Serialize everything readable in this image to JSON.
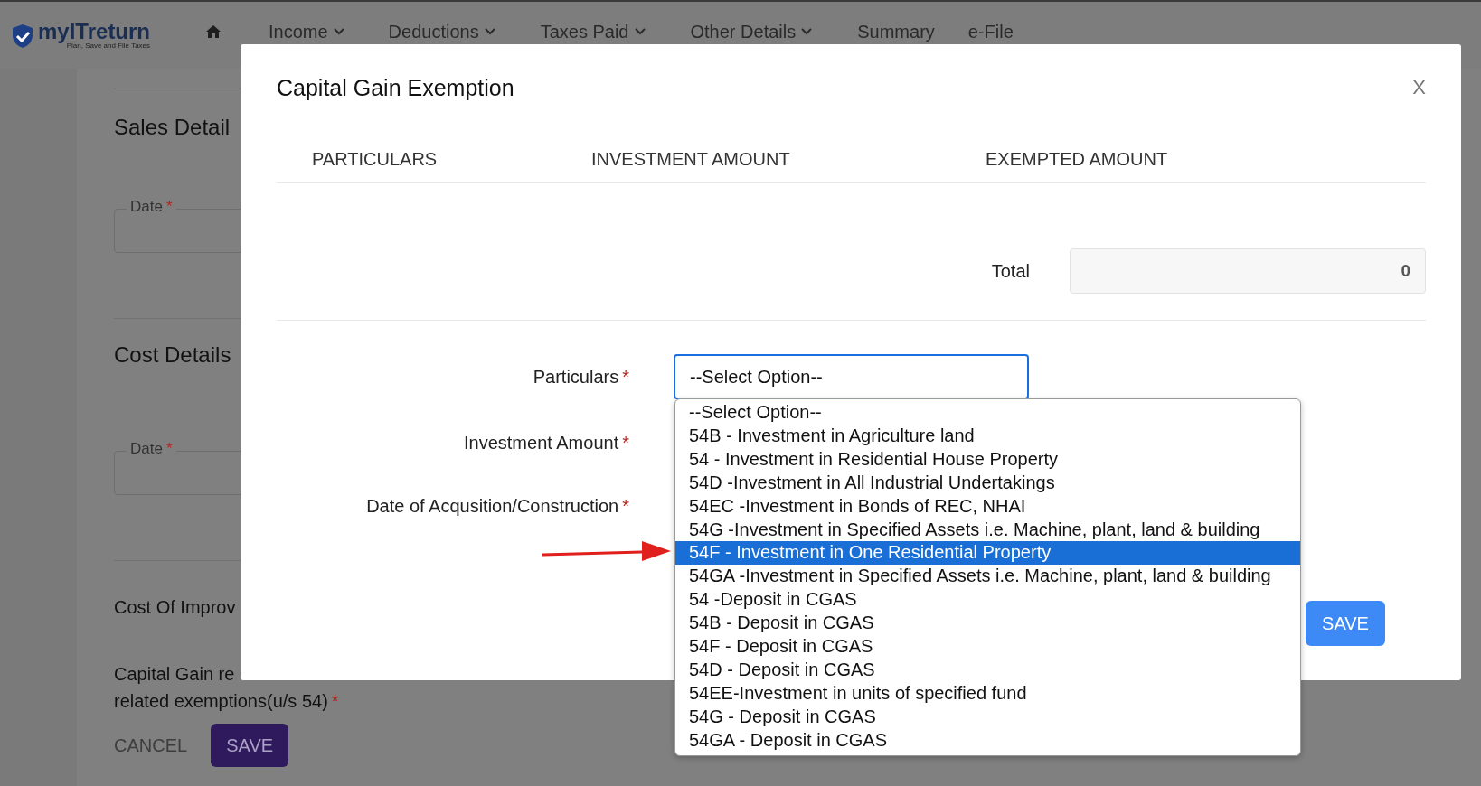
{
  "header": {
    "logo": {
      "name": "myITreturn",
      "tagline": "Plan, Save and File Taxes"
    },
    "nav": [
      {
        "label": "Income",
        "dropdown": true
      },
      {
        "label": "Deductions",
        "dropdown": true
      },
      {
        "label": "Taxes Paid",
        "dropdown": true
      },
      {
        "label": "Other Details",
        "dropdown": true
      },
      {
        "label": "Summary",
        "dropdown": false
      },
      {
        "label": "e-File",
        "dropdown": false
      }
    ]
  },
  "background_form": {
    "sections": [
      {
        "heading": "Sales Detail",
        "date_label": "Date",
        "required_mark": "*"
      },
      {
        "heading": "Cost Details",
        "date_label": "Date",
        "required_mark": "*"
      }
    ],
    "improvement_label": "Cost Of Improv",
    "capital_gain_lines": [
      "Capital Gain re",
      "related exemptions(u/s 54)"
    ],
    "capital_gain_required_mark": "*",
    "cancel": "CANCEL",
    "save": "SAVE"
  },
  "modal": {
    "title": "Capital Gain Exemption",
    "close": "X",
    "columns": [
      "PARTICULARS",
      "INVESTMENT AMOUNT",
      "EXEMPTED AMOUNT"
    ],
    "total": {
      "label": "Total",
      "value": "0"
    },
    "fields": [
      {
        "label": "Particulars",
        "required_mark": "*",
        "kind": "select"
      },
      {
        "label": "Investment Amount",
        "required_mark": "*",
        "kind": "hidden"
      },
      {
        "label": "Date of Acqusition/Construction",
        "required_mark": "*",
        "kind": "hidden"
      }
    ],
    "select": {
      "value": "--Select Option--",
      "expanded": true,
      "options": [
        {
          "label": "--Select Option--",
          "highlighted": false
        },
        {
          "label": "54B - Investment in Agriculture land",
          "highlighted": false
        },
        {
          "label": "54 - Investment in Residential House Property",
          "highlighted": false
        },
        {
          "label": "54D -Investment in All Industrial Undertakings",
          "highlighted": false
        },
        {
          "label": "54EC -Investment in Bonds of REC, NHAI",
          "highlighted": false
        },
        {
          "label": "54G -Investment in Specified Assets i.e. Machine, plant, land & building",
          "highlighted": false
        },
        {
          "label": "54F - Investment in One Residential Property",
          "highlighted": true
        },
        {
          "label": "54GA -Investment in Specified Assets i.e. Machine, plant, land & building",
          "highlighted": false
        },
        {
          "label": "54 -Deposit in CGAS",
          "highlighted": false
        },
        {
          "label": "54B - Deposit in CGAS",
          "highlighted": false
        },
        {
          "label": "54F - Deposit in CGAS",
          "highlighted": false
        },
        {
          "label": "54D - Deposit in CGAS",
          "highlighted": false
        },
        {
          "label": "54EE-Investment in units of specified fund",
          "highlighted": false
        },
        {
          "label": "54G - Deposit in CGAS",
          "highlighted": false
        },
        {
          "label": "54GA - Deposit in CGAS",
          "highlighted": false
        }
      ]
    },
    "save": "SAVE"
  }
}
